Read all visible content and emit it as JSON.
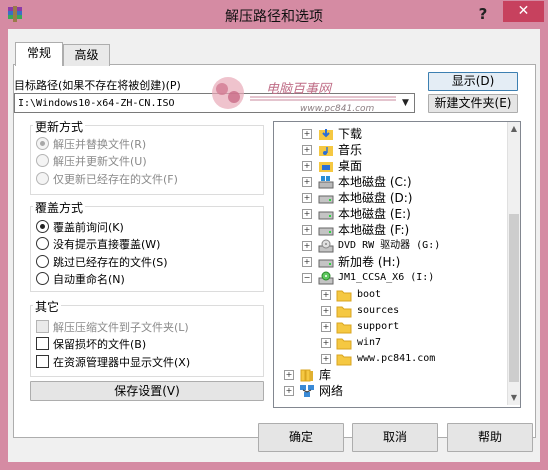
{
  "window": {
    "title": "解压路径和选项",
    "help_glyph": "?",
    "close_glyph": "✕"
  },
  "tabs": [
    {
      "label": "常规"
    },
    {
      "label": "高级"
    }
  ],
  "dest": {
    "label": "目标路径(如果不存在将被创建)(P)",
    "value": "I:\\Windows10-x64-ZH-CN.ISO"
  },
  "buttons": {
    "display": "显示(D)",
    "new_folder": "新建文件夹(E)",
    "save": "保存设置(V)",
    "ok": "确定",
    "cancel": "取消",
    "help": "帮助"
  },
  "update_mode": {
    "title": "更新方式",
    "options": [
      {
        "label": "解压并替换文件(R)",
        "selected": true
      },
      {
        "label": "解压并更新文件(U)",
        "selected": false
      },
      {
        "label": "仅更新已经存在的文件(F)",
        "selected": false
      }
    ]
  },
  "overwrite_mode": {
    "title": "覆盖方式",
    "options": [
      {
        "label": "覆盖前询问(K)",
        "selected": true
      },
      {
        "label": "没有提示直接覆盖(W)",
        "selected": false
      },
      {
        "label": "跳过已经存在的文件(S)",
        "selected": false
      },
      {
        "label": "自动重命名(N)",
        "selected": false
      }
    ]
  },
  "misc": {
    "title": "其它",
    "options": [
      {
        "label": "解压压缩文件到子文件夹(L)",
        "checked": false
      },
      {
        "label": "保留损坏的文件(B)",
        "checked": false
      },
      {
        "label": "在资源管理器中显示文件(X)",
        "checked": false
      }
    ]
  },
  "tree": {
    "items": [
      {
        "label": "下载",
        "icon": "download-folder-icon"
      },
      {
        "label": "音乐",
        "icon": "music-folder-icon"
      },
      {
        "label": "桌面",
        "icon": "desktop-folder-icon"
      },
      {
        "label": "本地磁盘 (C:)",
        "icon": "windows-drive-icon"
      },
      {
        "label": "本地磁盘 (D:)",
        "icon": "drive-icon"
      },
      {
        "label": "本地磁盘 (E:)",
        "icon": "drive-icon"
      },
      {
        "label": "本地磁盘 (F:)",
        "icon": "drive-icon"
      },
      {
        "label": "DVD RW 驱动器 (G:)",
        "icon": "dvd-drive-icon"
      },
      {
        "label": "新加卷 (H:)",
        "icon": "drive-icon"
      },
      {
        "label": "JM1_CCSA_X6 (I:)",
        "icon": "dvd-disc-icon"
      },
      {
        "label": "boot",
        "icon": "folder-icon"
      },
      {
        "label": "sources",
        "icon": "folder-icon"
      },
      {
        "label": "support",
        "icon": "folder-icon"
      },
      {
        "label": "win7",
        "icon": "folder-icon"
      },
      {
        "label": "www.pc841.com",
        "icon": "folder-icon"
      },
      {
        "label": "库",
        "icon": "library-icon"
      },
      {
        "label": "网络",
        "icon": "network-icon"
      }
    ]
  },
  "watermark": {
    "text": "电脑百事网",
    "url": "www.pc841.com"
  },
  "colors": {
    "frame": "#d58ba3",
    "close": "#c7415e",
    "folder": "#f5c842",
    "selection": "#3c7fb1"
  }
}
